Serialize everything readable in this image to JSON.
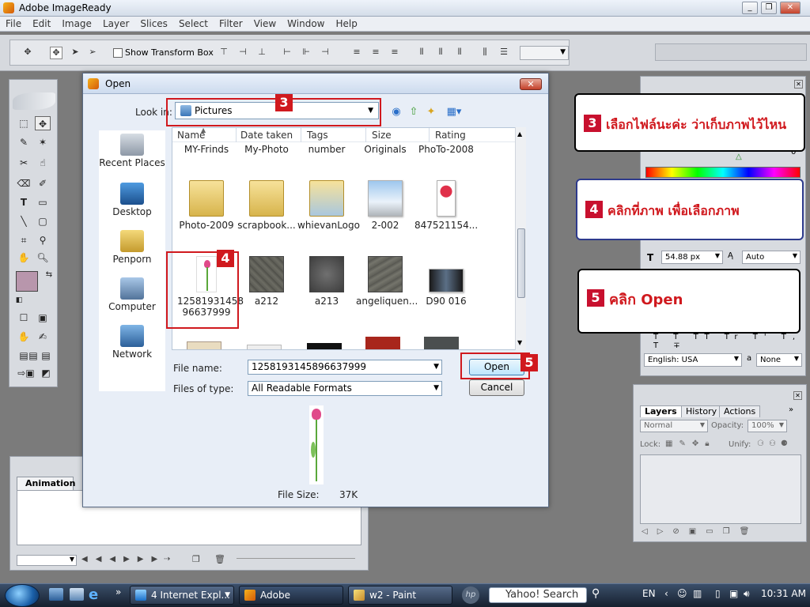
{
  "app": {
    "title": "Adobe ImageReady"
  },
  "menu": [
    "File",
    "Edit",
    "Image",
    "Layer",
    "Slices",
    "Select",
    "Filter",
    "View",
    "Window",
    "Help"
  ],
  "options": {
    "show_transform_box": "Show Transform Box"
  },
  "animation_panel": {
    "tab": "Animation"
  },
  "type_panel": {
    "font_size": "54.88 px",
    "leading": "Auto",
    "language": "English: USA",
    "aa_label": "a",
    "aa_value": "None",
    "value_field": "0"
  },
  "layers_panel": {
    "tabs": [
      "Layers",
      "History",
      "Actions"
    ],
    "blend_mode": "Normal",
    "opacity_label": "Opacity:",
    "opacity": "100%",
    "lock_label": "Lock:",
    "unify_label": "Unify:"
  },
  "dialog": {
    "title": "Open",
    "look_in_label": "Look in:",
    "look_in_value": "Pictures",
    "places": [
      "Recent Places",
      "Desktop",
      "Penporn",
      "Computer",
      "Network"
    ],
    "columns": [
      "Name",
      "Date taken",
      "Tags",
      "Size",
      "Rating"
    ],
    "top_row": [
      "MY-Frinds",
      "My-Photo",
      "number",
      "Originals",
      "PhoTo-2008"
    ],
    "row1": [
      "Photo-2009",
      "scrapbook...",
      "whievanLogo",
      "2-002",
      "847521154..."
    ],
    "row2": [
      "1258193145896637999",
      "a212",
      "a213",
      "angeliquen...",
      "D90 016"
    ],
    "row2_first_line1": "12581931458",
    "row2_first_line2": "96637999",
    "file_name_label": "File name:",
    "file_name_value": "1258193145896637999",
    "file_type_label": "Files of type:",
    "file_type_value": "All Readable Formats",
    "open_button": "Open",
    "cancel_button": "Cancel",
    "file_size_label": "File Size:",
    "file_size_value": "37K"
  },
  "annotations": {
    "badge3": "3",
    "badge4": "4",
    "badge5": "5",
    "callout3_text": "เลือกไฟล์นะค่ะ  ว่าเก็บภาพไว้ไหน",
    "callout4_text": "คลิกที่ภาพ  เพื่อเลือกภาพ",
    "callout5_text": "คลิก  Open"
  },
  "taskbar": {
    "tasks": [
      "4 Internet Expl...",
      "Adobe ImageRe...",
      "w2 - Paint"
    ],
    "search": "Yahoo! Search",
    "lang": "EN",
    "time": "10:31 AM"
  },
  "colors": {
    "annotation_red": "#d0191e",
    "callout_border": "#000000",
    "callout4_border": "#2d3a8c",
    "foreground_swatch": "#b896ac"
  }
}
